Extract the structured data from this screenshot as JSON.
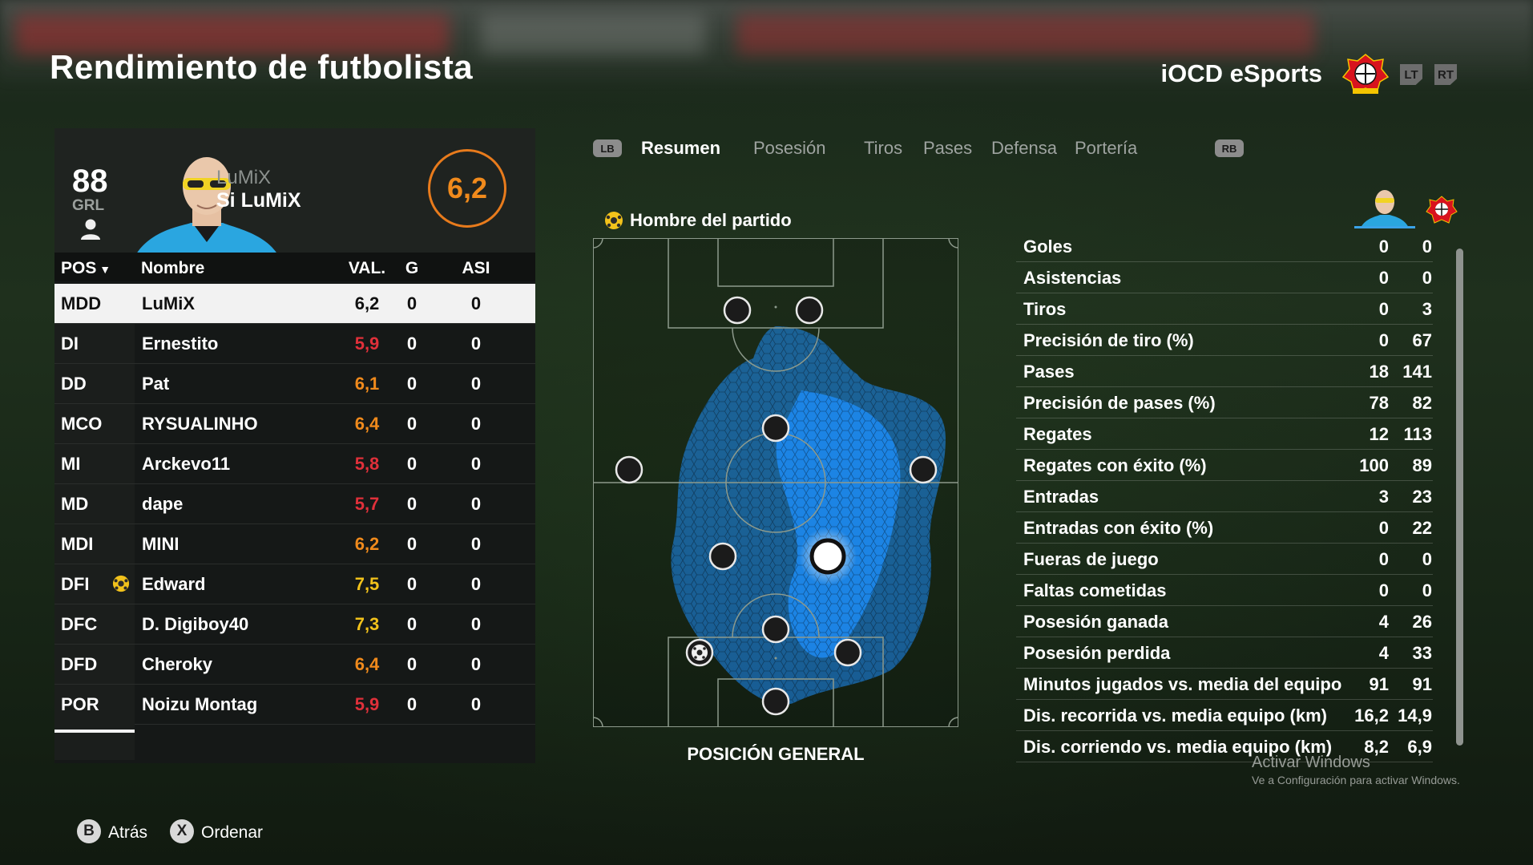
{
  "page": {
    "title": "Rendimiento de futbolista"
  },
  "header": {
    "team_name": "iOCD eSports",
    "lt": "LT",
    "rt": "RT"
  },
  "player": {
    "overall": "88",
    "overall_label": "GRL",
    "tag": "LuMiX",
    "name": "Si LuMiX",
    "rating": "6,2",
    "rating_color": "#f08a1c"
  },
  "table": {
    "headers": {
      "pos": "POS",
      "name": "Nombre",
      "val": "VAL.",
      "g": "G",
      "asi": "ASI"
    },
    "rows": [
      {
        "pos": "MDD",
        "name": "LuMiX",
        "val": "6,2",
        "g": "0",
        "asi": "0",
        "val_color": "#111111",
        "selected": true
      },
      {
        "pos": "DI",
        "name": "Ernestito",
        "val": "5,9",
        "g": "0",
        "asi": "0",
        "val_color": "#e0303a"
      },
      {
        "pos": "DD",
        "name": "Pat",
        "val": "6,1",
        "g": "0",
        "asi": "0",
        "val_color": "#f08a1c"
      },
      {
        "pos": "MCO",
        "name": "RYSUALINHO",
        "val": "6,4",
        "g": "0",
        "asi": "0",
        "val_color": "#f08a1c"
      },
      {
        "pos": "MI",
        "name": "Arckevo11",
        "val": "5,8",
        "g": "0",
        "asi": "0",
        "val_color": "#e0303a"
      },
      {
        "pos": "MD",
        "name": "dape",
        "val": "5,7",
        "g": "0",
        "asi": "0",
        "val_color": "#e0303a"
      },
      {
        "pos": "MDI",
        "name": "MINI",
        "val": "6,2",
        "g": "0",
        "asi": "0",
        "val_color": "#f08a1c"
      },
      {
        "pos": "DFI",
        "name": "Edward",
        "val": "7,5",
        "g": "0",
        "asi": "0",
        "val_color": "#f2c21b",
        "motm": true
      },
      {
        "pos": "DFC",
        "name": "D. Digiboy40",
        "val": "7,3",
        "g": "0",
        "asi": "0",
        "val_color": "#f2c21b"
      },
      {
        "pos": "DFD",
        "name": "Cheroky",
        "val": "6,4",
        "g": "0",
        "asi": "0",
        "val_color": "#f08a1c"
      },
      {
        "pos": "POR",
        "name": "Noizu Montag",
        "val": "5,9",
        "g": "0",
        "asi": "0",
        "val_color": "#e0303a"
      }
    ]
  },
  "tabs": {
    "lb": "LB",
    "rb": "RB",
    "items": [
      "Resumen",
      "Posesión",
      "Tiros",
      "Pases",
      "Defensa",
      "Portería"
    ],
    "active": 0
  },
  "pitch": {
    "motm_label": "Hombre del partido",
    "label": "POSICIÓN GENERAL",
    "heat_color": "#1e90ff"
  },
  "stats": [
    {
      "label": "Goles",
      "player": "0",
      "team": "0"
    },
    {
      "label": "Asistencias",
      "player": "0",
      "team": "0"
    },
    {
      "label": "Tiros",
      "player": "0",
      "team": "3"
    },
    {
      "label": "Precisión de tiro (%)",
      "player": "0",
      "team": "67"
    },
    {
      "label": "Pases",
      "player": "18",
      "team": "141"
    },
    {
      "label": "Precisión de pases (%)",
      "player": "78",
      "team": "82"
    },
    {
      "label": "Regates",
      "player": "12",
      "team": "113"
    },
    {
      "label": "Regates con éxito (%)",
      "player": "100",
      "team": "89"
    },
    {
      "label": "Entradas",
      "player": "3",
      "team": "23"
    },
    {
      "label": "Entradas con éxito (%)",
      "player": "0",
      "team": "22"
    },
    {
      "label": "Fueras de juego",
      "player": "0",
      "team": "0"
    },
    {
      "label": "Faltas cometidas",
      "player": "0",
      "team": "0"
    },
    {
      "label": "Posesión ganada",
      "player": "4",
      "team": "26"
    },
    {
      "label": "Posesión perdida",
      "player": "4",
      "team": "33"
    },
    {
      "label": "Minutos jugados vs. media del equipo",
      "player": "91",
      "team": "91"
    },
    {
      "label": "Dis. recorrida vs. media equipo (km)",
      "player": "16,2",
      "team": "14,9"
    },
    {
      "label": "Dis. corriendo vs. media equipo (km)",
      "player": "8,2",
      "team": "6,9"
    }
  ],
  "watermark": {
    "line1": "Activar Windows",
    "line2": "Ve a Configuración para activar Windows."
  },
  "footer": {
    "back_key": "B",
    "back_label": "Atrás",
    "sort_key": "X",
    "sort_label": "Ordenar"
  }
}
